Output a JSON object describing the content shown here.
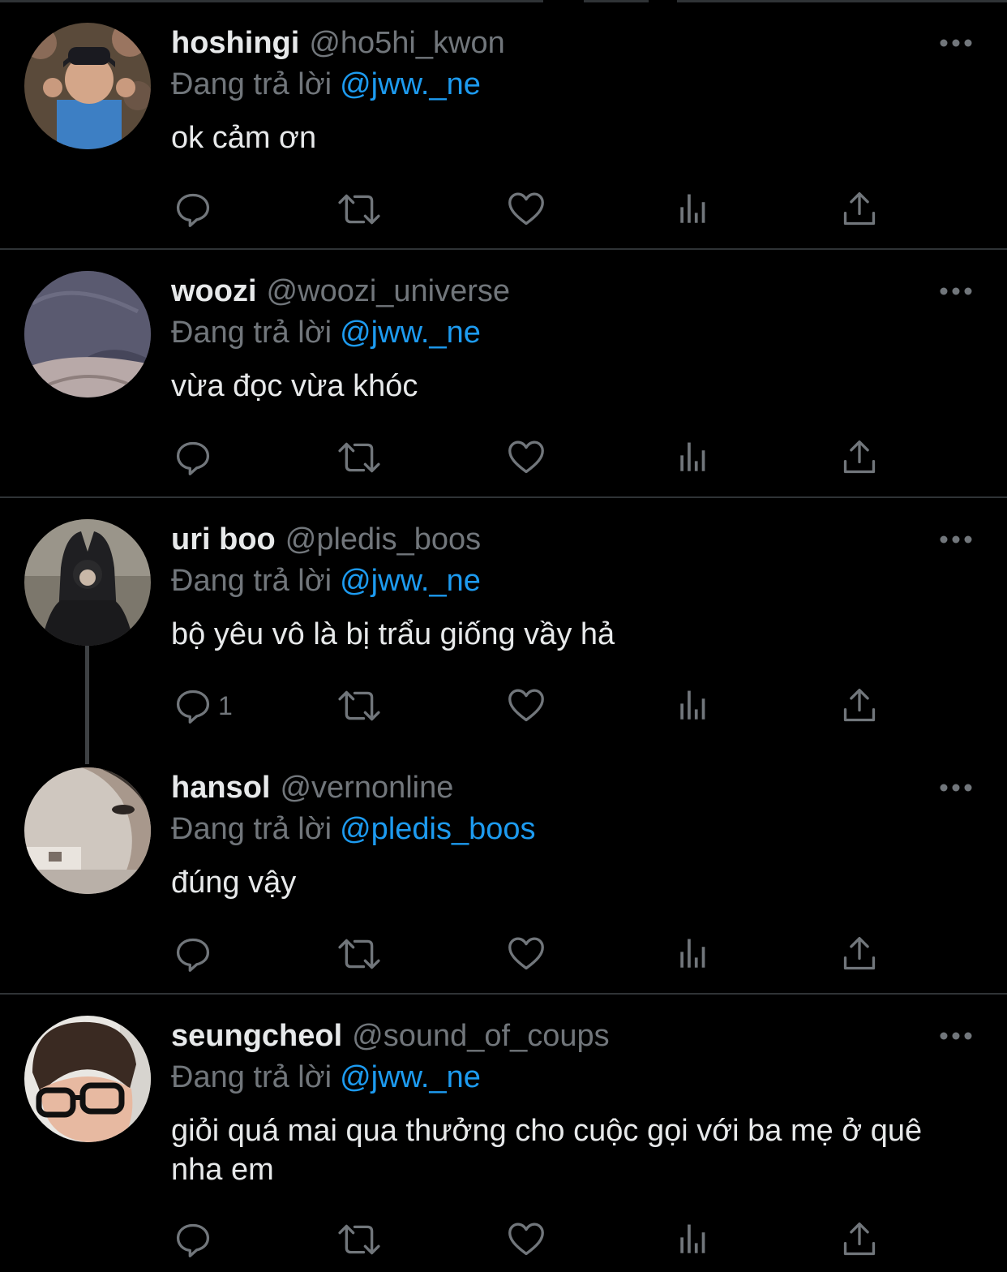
{
  "reply_prefix": "Đang trả lời",
  "tweets": [
    {
      "name": "hoshingi",
      "handle": "@ho5hi_kwon",
      "reply_to": "@jww._ne",
      "text": "ok cảm ơn",
      "reply_count": ""
    },
    {
      "name": "woozi",
      "handle": "@woozi_universe",
      "reply_to": "@jww._ne",
      "text": "vừa đọc vừa khóc",
      "reply_count": ""
    },
    {
      "name": "uri boo",
      "handle": "@pledis_boos",
      "reply_to": "@jww._ne",
      "text": "bộ yêu vô là bị trẩu giống vầy hả",
      "reply_count": "1"
    },
    {
      "name": "hansol",
      "handle": "@vernonline",
      "reply_to": "@pledis_boos",
      "text": "đúng vậy",
      "reply_count": ""
    },
    {
      "name": "seungcheol",
      "handle": "@sound_of_coups",
      "reply_to": "@jww._ne",
      "text": "giỏi quá mai qua thưởng cho cuộc gọi với ba mẹ ở quê nha em",
      "reply_count": ""
    }
  ],
  "icons": {
    "reply": "reply-icon",
    "retweet": "retweet-icon",
    "like": "like-icon",
    "views": "views-icon",
    "share": "share-icon",
    "more": "more-options-icon"
  },
  "colors": {
    "background": "#000000",
    "name": "#e7e9ea",
    "handle": "#71767b",
    "mention": "#1d9bf0",
    "divider": "#2f3336"
  }
}
